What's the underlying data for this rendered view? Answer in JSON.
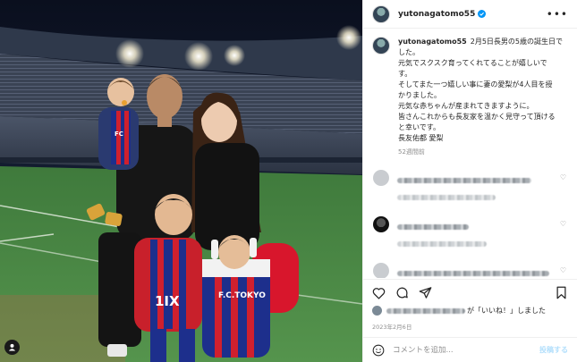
{
  "post": {
    "username": "yutonagatomo55",
    "more_icon": "more-horizontal-icon",
    "caption": {
      "username": "yutonagatomo55",
      "lines": [
        "2月5日長男の5歳の誕生日で",
        "した。",
        "元気でスクスク育ってくれてることが嬉しいで",
        "す。",
        "そしてまた一つ嬉しい事に妻の愛梨が4人目を授",
        "かりました。",
        "元気な赤ちゃんが産まれてきますように。",
        "皆さんこれからも長友家を温かく見守って頂ける",
        "と幸いです。",
        "長友佑都 愛梨"
      ],
      "time": "52週間前"
    },
    "comments": [
      {
        "avatar_color": "#c9ccd0"
      },
      {
        "avatar_color": "#2c2c2c"
      },
      {
        "avatar_color": "#c9ccd0"
      }
    ],
    "actions": {
      "like_icon": "heart-icon",
      "comment_icon": "comment-icon",
      "share_icon": "send-icon",
      "save_icon": "bookmark-icon"
    },
    "likes_text": "が「いいね！」しました",
    "date": "2023年2月6日",
    "add_comment": {
      "placeholder": "コメントを追加...",
      "post_label": "投稿する"
    },
    "photo": {
      "jersey_text_kid1": "1IX",
      "jersey_text_kid2": "F.C.TOKYO",
      "jersey_text_baby": "FC"
    },
    "colors": {
      "verified": "#0095f6",
      "jersey_blue": "#1d2f8c",
      "jersey_red": "#d0202e",
      "post_button": "#b2dffc"
    }
  }
}
